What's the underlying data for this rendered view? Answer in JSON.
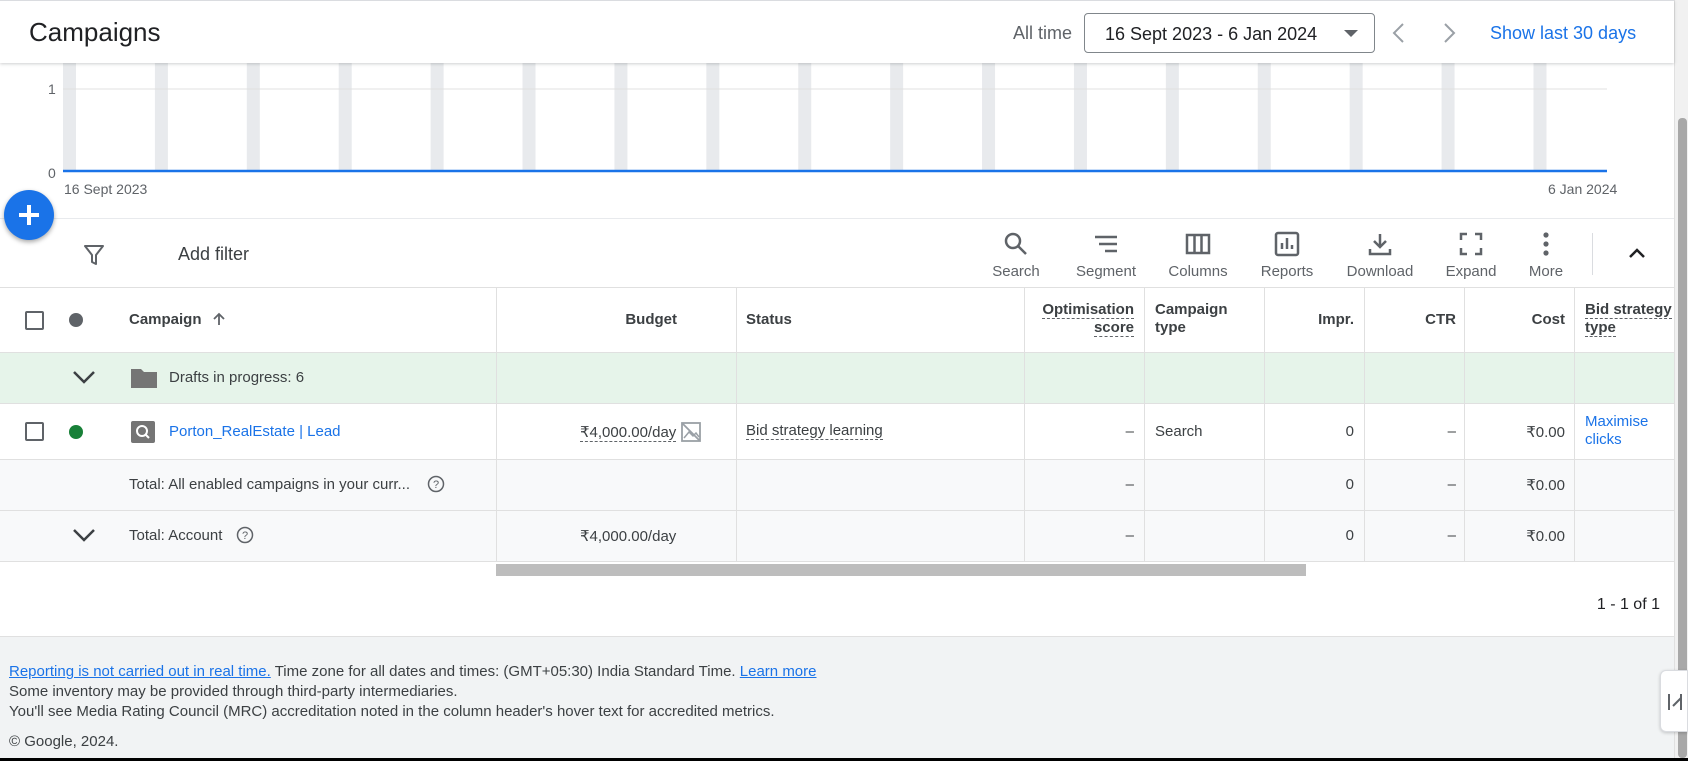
{
  "header": {
    "title": "Campaigns",
    "all_time_label": "All time",
    "date_range": "16 Sept 2023 - 6 Jan 2024",
    "show_last_label": "Show last 30 days"
  },
  "chart_data": {
    "type": "line",
    "x": [
      "16 Sept 2023",
      "6 Jan 2024"
    ],
    "series": [
      {
        "values": [
          0,
          0
        ]
      }
    ],
    "y_ticks": [
      "1",
      "0"
    ],
    "ylim": [
      0,
      1
    ],
    "x_start_label": "16 Sept 2023",
    "x_end_label": "6 Jan 2024",
    "colors": {
      "line": "#1a73e8",
      "band": "#e8eaed",
      "grid": "#e0e0e0"
    }
  },
  "toolbar": {
    "add_filter": "Add filter",
    "tools": [
      {
        "label": "Search",
        "icon": "search-icon"
      },
      {
        "label": "Segment",
        "icon": "segment-icon"
      },
      {
        "label": "Columns",
        "icon": "columns-icon"
      },
      {
        "label": "Reports",
        "icon": "reports-icon"
      },
      {
        "label": "Download",
        "icon": "download-icon"
      },
      {
        "label": "Expand",
        "icon": "expand-icon"
      },
      {
        "label": "More",
        "icon": "more-vert-icon"
      }
    ]
  },
  "table": {
    "headers": {
      "campaign": "Campaign",
      "budget": "Budget",
      "status": "Status",
      "optimisation_score_1": "Optimisation",
      "optimisation_score_2": "score",
      "campaign_type_1": "Campaign",
      "campaign_type_2": "type",
      "impr": "Impr.",
      "ctr": "CTR",
      "cost": "Cost",
      "bid_strategy_1": "Bid strategy",
      "bid_strategy_2": "type"
    },
    "drafts_label": "Drafts in progress: 6",
    "campaign_row": {
      "name": "Porton_RealEstate | Lead",
      "budget": "₹4,000.00/day",
      "status": "Bid strategy learning",
      "optimisation_score": "–",
      "campaign_type": "Search",
      "impr": "0",
      "ctr": "–",
      "cost": "₹0.00",
      "bid_strategy_1": "Maximise",
      "bid_strategy_2": "clicks"
    },
    "total_enabled": {
      "label": "Total: All enabled campaigns in your curr...",
      "optimisation_score": "–",
      "impr": "0",
      "ctr": "–",
      "cost": "₹0.00"
    },
    "total_account": {
      "label": "Total: Account",
      "budget": "₹4,000.00/day",
      "optimisation_score": "–",
      "impr": "0",
      "ctr": "–",
      "cost": "₹0.00"
    }
  },
  "pagination": "1 - 1 of 1",
  "footer": {
    "reporting_link": "Reporting is not carried out in real time.",
    "timezone_text": " Time zone for all dates and times: (GMT+05:30) India Standard Time. ",
    "learn_more": "Learn more",
    "inventory_text": "Some inventory may be provided through third-party intermediaries.",
    "mrc_text": "You'll see Media Rating Council (MRC) accreditation noted in the column header's hover text for accredited metrics.",
    "copyright": "© Google, 2024."
  },
  "colors": {
    "accent": "#1a73e8",
    "enabled_status": "#188038",
    "drafts_row_bg": "#e6f4ea"
  }
}
